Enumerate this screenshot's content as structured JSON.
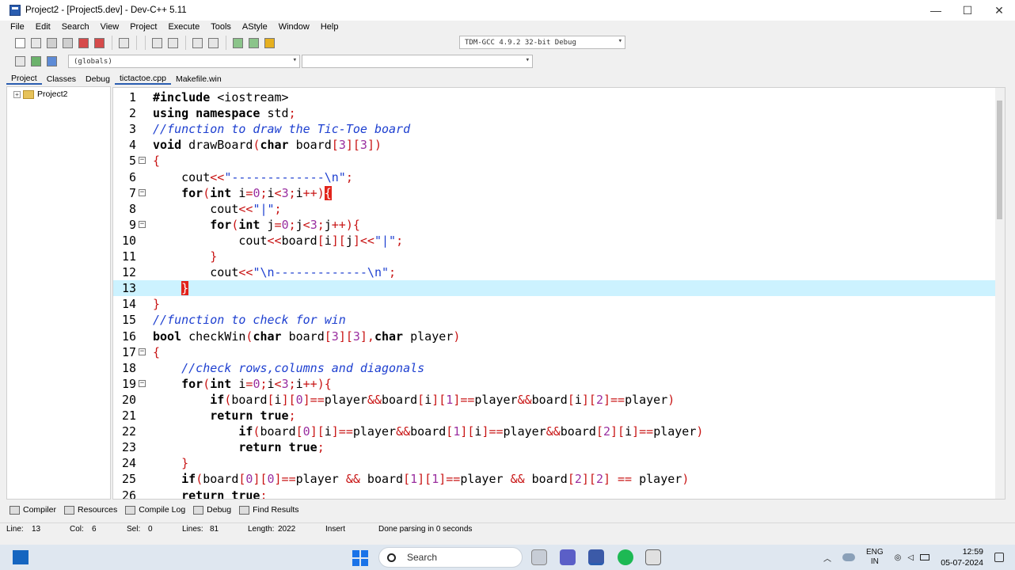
{
  "window": {
    "title": "Project2 - [Project5.dev] - Dev-C++ 5.11",
    "minimize_glyph": "—",
    "maximize_glyph": "☐",
    "close_glyph": "✕"
  },
  "menu": [
    "File",
    "Edit",
    "Search",
    "View",
    "Project",
    "Execute",
    "Tools",
    "AStyle",
    "Window",
    "Help"
  ],
  "toolbar": {
    "compiler_select": "TDM-GCC 4.9.2 32-bit Debug",
    "scope_select": "(globals)",
    "function_select": ""
  },
  "left_panel": {
    "tabs": [
      "Project",
      "Classes",
      "Debug"
    ],
    "tree_root": "Project2"
  },
  "file_tabs": [
    "tictactoe.cpp",
    "Makefile.win"
  ],
  "editor": {
    "lines": [
      {
        "n": "1",
        "html": "<span class=\"kw\">#include</span> &lt;iostream&gt;"
      },
      {
        "n": "2",
        "html": "<span class=\"kw\">using namespace</span> std<span class=\"op\">;</span>"
      },
      {
        "n": "3",
        "html": "<span class=\"cm\">//function to draw the Tic-Toe board</span>"
      },
      {
        "n": "4",
        "html": "<span class=\"kw\">void</span> drawBoard<span class=\"op\">(</span><span class=\"kw\">char</span> board<span class=\"op\">[</span><span class=\"nm\">3</span><span class=\"op\">][</span><span class=\"nm\">3</span><span class=\"op\">])</span>"
      },
      {
        "n": "5",
        "html": "<span class=\"op\">{</span>",
        "fold": true
      },
      {
        "n": "6",
        "html": "    cout<span class=\"op\">&lt;&lt;</span><span class=\"st\">\"-------------\\n\"</span><span class=\"op\">;</span>"
      },
      {
        "n": "7",
        "html": "    <span class=\"kw\">for</span><span class=\"op\">(</span><span class=\"kw\">int</span> i<span class=\"op\">=</span><span class=\"nm\">0</span><span class=\"op\">;</span>i<span class=\"op\">&lt;</span><span class=\"nm\">3</span><span class=\"op\">;</span>i<span class=\"op\">++)</span><span class=\"br-hl\">{</span>",
        "fold": true
      },
      {
        "n": "8",
        "html": "        cout<span class=\"op\">&lt;&lt;</span><span class=\"st\">\"|\"</span><span class=\"op\">;</span>"
      },
      {
        "n": "9",
        "html": "        <span class=\"kw\">for</span><span class=\"op\">(</span><span class=\"kw\">int</span> j<span class=\"op\">=</span><span class=\"nm\">0</span><span class=\"op\">;</span>j<span class=\"op\">&lt;</span><span class=\"nm\">3</span><span class=\"op\">;</span>j<span class=\"op\">++){</span>",
        "fold": true
      },
      {
        "n": "10",
        "html": "            cout<span class=\"op\">&lt;&lt;</span>board<span class=\"op\">[</span>i<span class=\"op\">][</span>j<span class=\"op\">]&lt;&lt;</span><span class=\"st\">\"|\"</span><span class=\"op\">;</span>"
      },
      {
        "n": "11",
        "html": "        <span class=\"op\">}</span>"
      },
      {
        "n": "12",
        "html": "        cout<span class=\"op\">&lt;&lt;</span><span class=\"st\">\"\\n-------------\\n\"</span><span class=\"op\">;</span>"
      },
      {
        "n": "13",
        "html": "    <span class=\"br-hl\">}</span>",
        "current": true
      },
      {
        "n": "14",
        "html": "<span class=\"op\">}</span>"
      },
      {
        "n": "15",
        "html": "<span class=\"cm\">//function to check for win</span>"
      },
      {
        "n": "16",
        "html": "<span class=\"kw\">bool</span> checkWin<span class=\"op\">(</span><span class=\"kw\">char</span> board<span class=\"op\">[</span><span class=\"nm\">3</span><span class=\"op\">][</span><span class=\"nm\">3</span><span class=\"op\">],</span><span class=\"kw\">char</span> player<span class=\"op\">)</span>"
      },
      {
        "n": "17",
        "html": "<span class=\"op\">{</span>",
        "fold": true
      },
      {
        "n": "18",
        "html": "    <span class=\"cm\">//check rows,columns and diagonals</span>"
      },
      {
        "n": "19",
        "html": "    <span class=\"kw\">for</span><span class=\"op\">(</span><span class=\"kw\">int</span> i<span class=\"op\">=</span><span class=\"nm\">0</span><span class=\"op\">;</span>i<span class=\"op\">&lt;</span><span class=\"nm\">3</span><span class=\"op\">;</span>i<span class=\"op\">++){</span>",
        "fold": true
      },
      {
        "n": "20",
        "html": "        <span class=\"kw\">if</span><span class=\"op\">(</span>board<span class=\"op\">[</span>i<span class=\"op\">][</span><span class=\"nm\">0</span><span class=\"op\">]==</span>player<span class=\"op\">&amp;&amp;</span>board<span class=\"op\">[</span>i<span class=\"op\">][</span><span class=\"nm\">1</span><span class=\"op\">]==</span>player<span class=\"op\">&amp;&amp;</span>board<span class=\"op\">[</span>i<span class=\"op\">][</span><span class=\"nm\">2</span><span class=\"op\">]==</span>player<span class=\"op\">)</span>"
      },
      {
        "n": "21",
        "html": "        <span class=\"kw\">return true</span><span class=\"op\">;</span>"
      },
      {
        "n": "22",
        "html": "            <span class=\"kw\">if</span><span class=\"op\">(</span>board<span class=\"op\">[</span><span class=\"nm\">0</span><span class=\"op\">][</span>i<span class=\"op\">]==</span>player<span class=\"op\">&amp;&amp;</span>board<span class=\"op\">[</span><span class=\"nm\">1</span><span class=\"op\">][</span>i<span class=\"op\">]==</span>player<span class=\"op\">&amp;&amp;</span>board<span class=\"op\">[</span><span class=\"nm\">2</span><span class=\"op\">][</span>i<span class=\"op\">]==</span>player<span class=\"op\">)</span>"
      },
      {
        "n": "23",
        "html": "            <span class=\"kw\">return true</span><span class=\"op\">;</span>"
      },
      {
        "n": "24",
        "html": "    <span class=\"op\">}</span>"
      },
      {
        "n": "25",
        "html": "    <span class=\"kw\">if</span><span class=\"op\">(</span>board<span class=\"op\">[</span><span class=\"nm\">0</span><span class=\"op\">][</span><span class=\"nm\">0</span><span class=\"op\">]==</span>player <span class=\"op\">&amp;&amp;</span> board<span class=\"op\">[</span><span class=\"nm\">1</span><span class=\"op\">][</span><span class=\"nm\">1</span><span class=\"op\">]==</span>player <span class=\"op\">&amp;&amp;</span> board<span class=\"op\">[</span><span class=\"nm\">2</span><span class=\"op\">][</span><span class=\"nm\">2</span><span class=\"op\">]</span> <span class=\"op\">==</span> player<span class=\"op\">)</span>"
      },
      {
        "n": "26",
        "html": "    <span class=\"kw\">return true</span><span class=\"op\">;</span>"
      }
    ]
  },
  "bottom_tabs": [
    "Compiler",
    "Resources",
    "Compile Log",
    "Debug",
    "Find Results"
  ],
  "status": {
    "line_label": "Line:",
    "line_value": "13",
    "col_label": "Col:",
    "col_value": "6",
    "sel_label": "Sel:",
    "sel_value": "0",
    "lines_label": "Lines:",
    "lines_value": "81",
    "length_label": "Length:",
    "length_value": "2022",
    "mode": "Insert",
    "message": "Done parsing in 0 seconds"
  },
  "taskbar": {
    "search_label": "Search",
    "lang_top": "ENG",
    "lang_bottom": "IN",
    "time": "12:59",
    "date": "05-07-2024"
  },
  "colors": {
    "current_line": "#ccf2ff",
    "bracket_highlight": "#e2231a",
    "comment": "#1d3fd0",
    "number": "#9a2fa0",
    "operator": "#c81414"
  }
}
